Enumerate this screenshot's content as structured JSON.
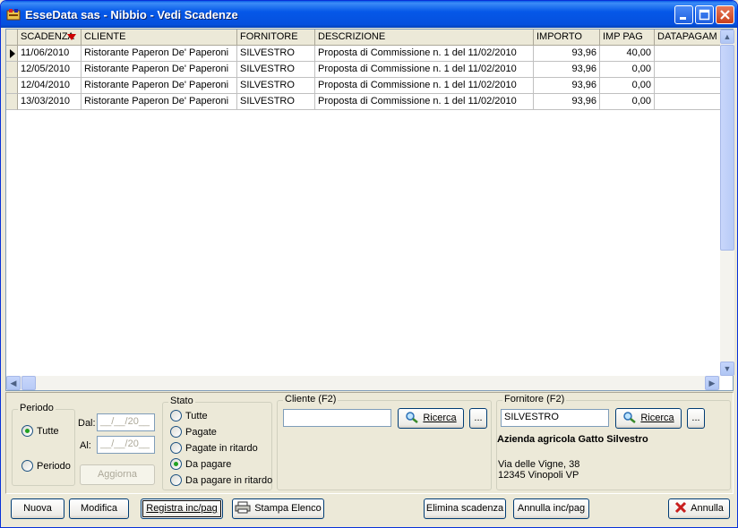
{
  "window": {
    "title": "EsseData sas - Nibbio - Vedi Scadenze"
  },
  "grid": {
    "columns": [
      "SCADENZA",
      "CLIENTE",
      "FORNITORE",
      "DESCRIZIONE",
      "IMPORTO",
      "IMP PAG",
      "DATAPAGAM"
    ],
    "rows": [
      [
        "11/06/2010",
        "Ristorante Paperon De' Paperoni",
        "SILVESTRO",
        "Proposta di Commissione n. 1 del 11/02/2010",
        "93,96",
        "40,00",
        ""
      ],
      [
        "12/05/2010",
        "Ristorante Paperon De' Paperoni",
        "SILVESTRO",
        "Proposta di Commissione n. 1 del 11/02/2010",
        "93,96",
        "0,00",
        ""
      ],
      [
        "12/04/2010",
        "Ristorante Paperon De' Paperoni",
        "SILVESTRO",
        "Proposta di Commissione n. 1 del 11/02/2010",
        "93,96",
        "0,00",
        ""
      ],
      [
        "13/03/2010",
        "Ristorante Paperon De' Paperoni",
        "SILVESTRO",
        "Proposta di Commissione n. 1 del 11/02/2010",
        "93,96",
        "0,00",
        ""
      ]
    ]
  },
  "periodo": {
    "label": "Periodo",
    "opt_tutte": "Tutte",
    "opt_periodo": "Periodo",
    "selected": "Tutte",
    "dal_label": "Dal:",
    "al_label": "Al:",
    "dal_value": "__/__/20__",
    "al_value": "__/__/20__",
    "aggiorna": "Aggiorna"
  },
  "stato": {
    "label": "Stato",
    "options": [
      "Tutte",
      "Pagate",
      "Pagate in ritardo",
      "Da pagare",
      "Da pagare in ritardo"
    ],
    "selected": "Da pagare"
  },
  "cliente": {
    "label": "Cliente (F2)",
    "value": "",
    "ricerca": "Ricerca",
    "more": "..."
  },
  "fornitore": {
    "label": "Fornitore (F2)",
    "value": "SILVESTRO",
    "ricerca": "Ricerca",
    "more": "...",
    "name": "Azienda agricola Gatto Silvestro",
    "address1": "Via delle Vigne, 38",
    "address2": "12345 Vinopoli VP"
  },
  "buttons": {
    "nuova": "Nuova",
    "modifica": "Modifica",
    "registra": "Registra inc/pag",
    "stampa": "Stampa Elenco",
    "elimina": "Elimina scadenza",
    "annulla_inc": "Annulla inc/pag",
    "annulla": "Annulla"
  },
  "colors": {
    "titlebar": "#0558e8",
    "sort_arrow": "#cc0000",
    "radio_on": "#21a121",
    "close_x": "#c81e1e"
  }
}
